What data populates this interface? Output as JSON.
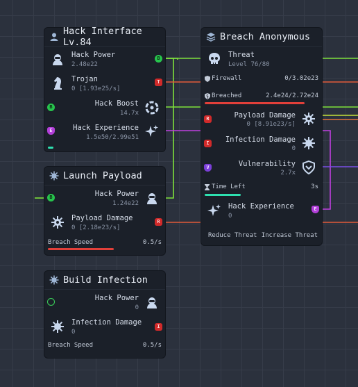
{
  "hack_interface": {
    "title": "Hack Interface Lv.84",
    "hack_power": {
      "label": "Hack Power",
      "value": "2.48e22"
    },
    "trojan": {
      "label": "Trojan",
      "value": "0 [1.93e25/s]"
    },
    "hack_boost": {
      "label": "Hack Boost",
      "value": "14.7x"
    },
    "hack_experience": {
      "label": "Hack Experience",
      "value": "1.5e50/2.99e51",
      "progress": 0.05
    }
  },
  "launch_payload": {
    "title": "Launch Payload",
    "hack_power": {
      "label": "Hack Power",
      "value": "1.24e22"
    },
    "payload_damage": {
      "label": "Payload Damage",
      "value": "0 [2.18e23/s]"
    },
    "breach_speed": {
      "label": "Breach Speed",
      "value": "0.5/s",
      "progress": 0.58
    }
  },
  "build_infection": {
    "title": "Build Infection",
    "hack_power": {
      "label": "Hack Power",
      "value": "0"
    },
    "infection_damage": {
      "label": "Infection Damage",
      "value": "0"
    },
    "breach_speed": {
      "label": "Breach Speed",
      "value": "0.5/s"
    }
  },
  "breach_anonymous": {
    "title": "Breach Anonymous",
    "threat": {
      "label": "Threat",
      "value": "Level 76/80"
    },
    "firewall": {
      "label": "Firewall",
      "value": "0/3.02e23"
    },
    "breached": {
      "label": "Breached",
      "value": "2.4e24/2.72e24",
      "progress": 0.88
    },
    "payload_damage": {
      "label": "Payload Damage",
      "value": "0 [8.91e23/s]"
    },
    "infection_damage": {
      "label": "Infection Damage",
      "value": "0"
    },
    "vulnerability": {
      "label": "Vulnerability",
      "value": "2.7x"
    },
    "time_left": {
      "label": "Time Left",
      "value": "3s",
      "progress": 0.32
    },
    "hack_experience": {
      "label": "Hack Experience",
      "value": "0"
    },
    "reduce_threat_label": "Reduce Threat",
    "increase_threat_label": "Increase Threat"
  },
  "ports": {
    "power": "B",
    "trojan": "T",
    "damage": "R",
    "infection": "I",
    "vulnerability": "V",
    "experience": "E"
  },
  "colors": {
    "power_wire": "#7ee23a",
    "damage_wire": "#e25a3a",
    "experience_wire": "#c040e0",
    "vulnerability_wire": "#7b4fe8",
    "breach_bar": "#e2403a",
    "experience_bar": "#2ee0b0",
    "time_bar": "#2ee0b0"
  }
}
